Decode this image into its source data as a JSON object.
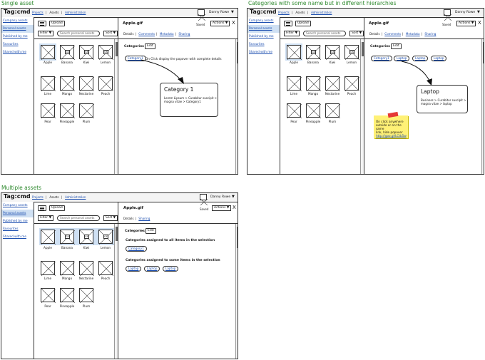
{
  "titles": {
    "single": "Single asset",
    "hier": "Categories with some name but in different hierarchies",
    "multi": "Multiple assets"
  },
  "app": {
    "logo": "Tag:cmd",
    "nav": [
      "Projects",
      "Assets",
      "Administration"
    ],
    "user": "Danny Rowe",
    "caret": "▼"
  },
  "sidebar": [
    "Company assets",
    "Personal assets",
    "Published by me",
    "Favourites",
    "Shared with me"
  ],
  "toolbar": {
    "upload": "Upload",
    "filter": "Filter ▼",
    "search_placeholder": "Search personal assets",
    "sort": "Sort ▼"
  },
  "thumbs": [
    {
      "label": "Apple"
    },
    {
      "label": "Banana",
      "tag": "GS"
    },
    {
      "label": "Kiwi",
      "tag": "GS"
    },
    {
      "label": "Lemon",
      "tag": "GS"
    },
    {
      "label": "Lime"
    },
    {
      "label": "Mango"
    },
    {
      "label": "Nectarine"
    },
    {
      "label": "Peach"
    },
    {
      "label": "Pear"
    },
    {
      "label": "Pineapple"
    },
    {
      "label": "Plum"
    }
  ],
  "details": {
    "title": "Apple.gif",
    "saved": "Saved",
    "actions": "Actions ▼",
    "close": "X",
    "tabs": [
      "Details",
      "Comments",
      "Metadata",
      "Sharing"
    ],
    "tabs_multi": [
      "Details",
      "Sharing"
    ],
    "categories_label": "Categories",
    "edit": "Edit"
  },
  "single": {
    "pill": "Category1",
    "hint": "On Click display the popover with complete details",
    "popover_title": "Category 1",
    "popover_body": [
      "Lorem Lipsum > Curabitur suscipit >",
      "magna vitae > Category1"
    ]
  },
  "hier": {
    "pills": [
      "Category1",
      "Laptop",
      "Laptop",
      "Laptop"
    ],
    "popover_title": "Laptop",
    "popover_body": [
      "Business > Curabitur suscipit >",
      "magna vitae > laptop"
    ],
    "sticky": [
      "On click anywhere",
      "outside or on the same",
      "link, hide popover"
    ],
    "sticky_link": "http://goo.gl/LCtb5w"
  },
  "multi": {
    "all_label": "Categories assigned to all items in the selection",
    "all_pills": [
      "Category1"
    ],
    "some_label": "Categories assigned to some items in the selection",
    "some_pills": [
      "Laptop",
      "Laptop",
      "Laptop"
    ]
  }
}
